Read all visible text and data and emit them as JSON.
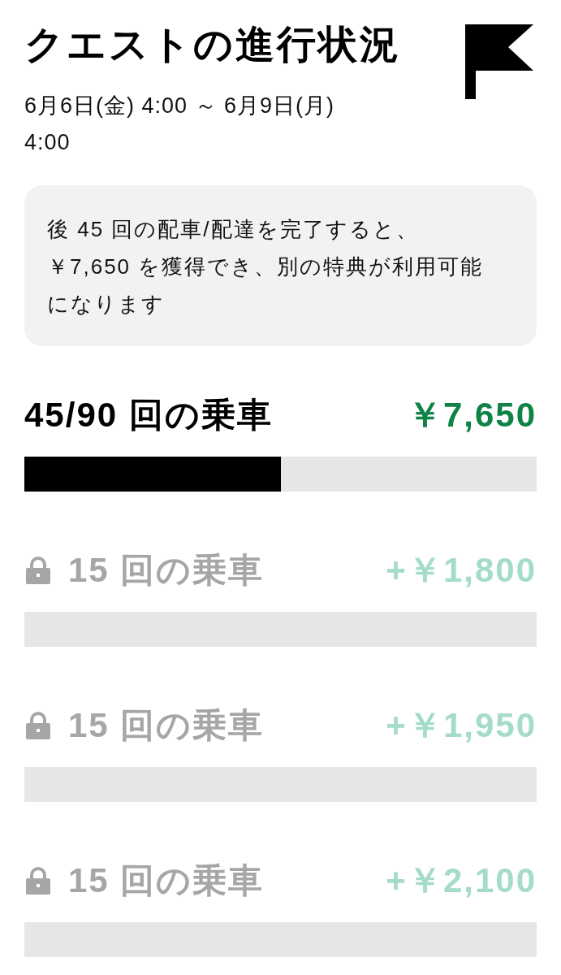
{
  "header": {
    "title": "クエストの進行状況",
    "date_range": "6月6日(金) 4:00 ～ 6月9日(月) 4:00"
  },
  "info": {
    "text": "後 45 回の配車/配達を完了すると、￥7,650 を獲得でき、別の特典が利用可能になります"
  },
  "milestones": [
    {
      "label": "45/90 回の乗車",
      "amount": "￥7,650",
      "locked": false,
      "level": 0.5
    },
    {
      "label": "15 回の乗車",
      "amount": "+￥1,800",
      "locked": true
    },
    {
      "label": "15 回の乗車",
      "amount": "+￥1,950",
      "locked": true
    },
    {
      "label": "15 回の乗車",
      "amount": "+￥2,100",
      "locked": true
    }
  ]
}
